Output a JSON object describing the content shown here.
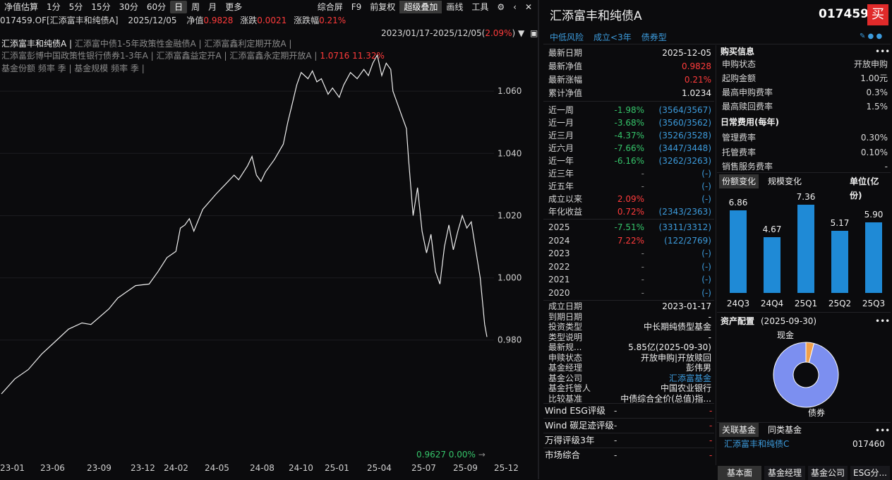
{
  "toolbar": {
    "left": [
      "净值估算",
      "1分",
      "5分",
      "15分",
      "30分",
      "60分",
      "日",
      "周",
      "月",
      "更多"
    ],
    "right": [
      "综合屏",
      "F9",
      "前复权",
      "超级叠加",
      "画线",
      "工具"
    ]
  },
  "info": {
    "code_name": "017459.OF[汇添富丰和纯债A]",
    "date": "2025/12/05",
    "nav_label": "净值",
    "nav": "0.9828",
    "chg_label": "涨跌",
    "chg": "0.0021",
    "pct_label": "涨跌幅",
    "pct": "0.21%"
  },
  "chart_overlay": {
    "range": "2023/01/17-2025/12/05(",
    "range_pct": "2.09%",
    "range_close": ")",
    "legend_main": "汇添富丰和纯债A |",
    "legend_1": "汇添富中债1-5年政策性金融债A |",
    "legend_2": "汇添富鑫利定期开放A |",
    "legend_3": "汇添富彭博中国政策性银行债券1-3年A |",
    "legend_4": "汇添富鑫益定开A |",
    "legend_5": "汇添富鑫永定期开放A |",
    "max_label": "1.0716 11.32%",
    "legend_6": "基金份额 频率 季 | 基金规模 频率 季 |",
    "min_label": "0.9627 0.00%"
  },
  "chart_data": {
    "type": "line",
    "x_ticks": [
      "23-01",
      "23-06",
      "23-09",
      "23-12",
      "24-02",
      "24-05",
      "24-08",
      "24-10",
      "25-01",
      "25-04",
      "25-07",
      "25-09",
      "25-12"
    ],
    "y_ticks": [
      "1.060",
      "1.040",
      "1.020",
      "1.000",
      "0.980"
    ],
    "ylim": [
      0.9627,
      1.0716
    ],
    "series": [
      {
        "points": [
          [
            0,
            0.9627
          ],
          [
            6,
            0.9675
          ],
          [
            12,
            0.9705
          ],
          [
            18,
            0.9755
          ],
          [
            24,
            0.9795
          ],
          [
            30,
            0.9835
          ],
          [
            36,
            0.9855
          ],
          [
            40,
            0.985
          ],
          [
            48,
            0.99
          ],
          [
            52,
            0.9935
          ],
          [
            56,
            0.9955
          ],
          [
            60,
            0.9975
          ],
          [
            66,
            0.998
          ],
          [
            70,
            1.002
          ],
          [
            74,
            1.0065
          ],
          [
            78,
            1.0085
          ],
          [
            80,
            1.016
          ],
          [
            82,
            1.017
          ],
          [
            84,
            1.019
          ],
          [
            86,
            1.015
          ],
          [
            90,
            1.022
          ],
          [
            96,
            1.027
          ],
          [
            100,
            1.03
          ],
          [
            104,
            1.033
          ],
          [
            106,
            1.0315
          ],
          [
            110,
            1.036
          ],
          [
            112,
            1.039
          ],
          [
            114,
            1.033
          ],
          [
            116,
            1.031
          ],
          [
            118,
            1.034
          ],
          [
            122,
            1.038
          ],
          [
            126,
            1.043
          ],
          [
            128,
            1.05
          ],
          [
            130,
            1.056
          ],
          [
            132,
            1.062
          ],
          [
            134,
            1.066
          ],
          [
            137,
            1.064
          ],
          [
            139,
            1.0665
          ],
          [
            141,
            1.063
          ],
          [
            143,
            1.064
          ],
          [
            146,
            1.059
          ],
          [
            148,
            1.061
          ],
          [
            151,
            1.058
          ],
          [
            153,
            1.062
          ],
          [
            156,
            1.066
          ],
          [
            159,
            1.064
          ],
          [
            162,
            1.067
          ],
          [
            164,
            1.065
          ],
          [
            166,
            1.069
          ],
          [
            168,
            1.0716
          ],
          [
            170,
            1.065
          ],
          [
            172,
            1.069
          ],
          [
            174,
            1.067
          ],
          [
            175,
            1.06
          ],
          [
            177,
            1.056
          ],
          [
            179,
            1.052
          ],
          [
            181,
            1.048
          ],
          [
            182,
            1.038
          ],
          [
            184,
            1.02
          ],
          [
            186,
            1.029
          ],
          [
            188,
            1.015
          ],
          [
            190,
            1.008
          ],
          [
            192,
            1.014
          ],
          [
            194,
            1.002
          ],
          [
            196,
            0.998
          ],
          [
            198,
            1.01
          ],
          [
            200,
            1.017
          ],
          [
            202,
            1.009
          ],
          [
            204,
            1.015
          ],
          [
            206,
            1.02
          ],
          [
            208,
            1.016
          ],
          [
            210,
            1.018
          ],
          [
            212,
            1.009
          ],
          [
            214,
            1.0
          ],
          [
            216,
            0.985
          ],
          [
            217,
            0.981
          ]
        ]
      }
    ]
  },
  "header": {
    "title": "汇添富丰和纯债A",
    "code": "017459",
    "buy": "买",
    "tags": [
      "中低风险",
      "成立<3年",
      "债券型"
    ]
  },
  "stats": [
    {
      "k": "最新日期",
      "v": "2025-12-05",
      "c": "white"
    },
    {
      "k": "最新净值",
      "v": "0.9828",
      "c": "red"
    },
    {
      "k": "最新涨幅",
      "v": "0.21%",
      "c": "red"
    },
    {
      "k": "累计净值",
      "v": "1.0234",
      "c": "white"
    }
  ],
  "perf": [
    {
      "k": "近一周",
      "v": "-1.98%",
      "r": "(3564/3567)",
      "c": "green"
    },
    {
      "k": "近一月",
      "v": "-3.68%",
      "r": "(3560/3562)",
      "c": "green"
    },
    {
      "k": "近三月",
      "v": "-4.37%",
      "r": "(3526/3528)",
      "c": "green"
    },
    {
      "k": "近六月",
      "v": "-7.66%",
      "r": "(3447/3448)",
      "c": "green"
    },
    {
      "k": "近一年",
      "v": "-6.16%",
      "r": "(3262/3263)",
      "c": "green"
    },
    {
      "k": "近三年",
      "v": "-",
      "r": "(-)",
      "c": "dim"
    },
    {
      "k": "近五年",
      "v": "-",
      "r": "(-)",
      "c": "dim"
    },
    {
      "k": "成立以来",
      "v": "2.09%",
      "r": "(-)",
      "c": "red"
    },
    {
      "k": "年化收益",
      "v": "0.72%",
      "r": "(2343/2363)",
      "c": "red"
    }
  ],
  "years": [
    {
      "k": "2025",
      "v": "-7.51%",
      "r": "(3311/3312)",
      "c": "green"
    },
    {
      "k": "2024",
      "v": "7.22%",
      "r": "(122/2769)",
      "c": "red"
    },
    {
      "k": "2023",
      "v": "-",
      "r": "(-)",
      "c": "dim"
    },
    {
      "k": "2022",
      "v": "-",
      "r": "(-)",
      "c": "dim"
    },
    {
      "k": "2021",
      "v": "-",
      "r": "(-)",
      "c": "dim"
    },
    {
      "k": "2020",
      "v": "-",
      "r": "(-)",
      "c": "dim"
    }
  ],
  "basic": [
    {
      "k": "成立日期",
      "v": "2023-01-17",
      "c": "white"
    },
    {
      "k": "到期日期",
      "v": "-",
      "c": "white"
    },
    {
      "k": "投资类型",
      "v": "中长期纯债型基金",
      "c": "white"
    },
    {
      "k": "类型说明",
      "v": "-",
      "c": "white"
    },
    {
      "k": "最新规...",
      "v": "5.85亿(2025-09-30)",
      "c": "white"
    },
    {
      "k": "申赎状态",
      "v": "开放申购|开放赎回",
      "c": "white"
    },
    {
      "k": "基金经理",
      "v": "彭伟男",
      "c": "white"
    },
    {
      "k": "基金公司",
      "v": "汇添富基金",
      "c": "blue"
    },
    {
      "k": "基金托管人",
      "v": "中国农业银行",
      "c": "white"
    },
    {
      "k": "比较基准",
      "v": "中债综合全价(总值)指...",
      "c": "white"
    }
  ],
  "ratings": [
    {
      "k": "Wind ESG评级",
      "v": "-",
      "v2": "-"
    },
    {
      "k": "Wind 碳足迹评级",
      "v": "-",
      "v2": "-"
    },
    {
      "k": "万得评级3年",
      "v": "-",
      "v2": "-"
    },
    {
      "k": "市场综合",
      "v": "-",
      "v2": "-"
    }
  ],
  "buy_info": {
    "title": "购买信息",
    "rows": [
      {
        "k": "申购状态",
        "v": "开放申购"
      },
      {
        "k": "起购金额",
        "v": "1.00元"
      },
      {
        "k": "最高申购费率",
        "v": "0.3%"
      },
      {
        "k": "最高赎回费率",
        "v": "1.5%"
      }
    ],
    "fee_title": "日常费用(每年)",
    "fees": [
      {
        "k": "管理费率",
        "v": "0.30%"
      },
      {
        "k": "托管费率",
        "v": "0.10%"
      },
      {
        "k": "销售服务费率",
        "v": "-"
      }
    ]
  },
  "share_chart": {
    "tab1": "份额变化",
    "tab2": "规模变化",
    "unit": "单位(亿份)",
    "bars": [
      {
        "q": "24Q3",
        "v": 6.86
      },
      {
        "q": "24Q4",
        "v": 4.67
      },
      {
        "q": "25Q1",
        "v": 7.36
      },
      {
        "q": "25Q2",
        "v": 5.17
      },
      {
        "q": "25Q3",
        "v": 5.9
      }
    ],
    "labels": [
      "6.86",
      "4.67",
      "7.36",
      "5.17",
      "5.90"
    ]
  },
  "asset": {
    "title": "资产配置",
    "date": "(2025-09-30)",
    "cash_label": "现金",
    "bond_label": "债券",
    "bond_pct": "96%",
    "bond_share": 96,
    "cash_share": 4,
    "bond_color": "#7c8ff0",
    "cash_color": "#f0a04a"
  },
  "related": {
    "tab1": "关联基金",
    "tab2": "同类基金",
    "name": "汇添富丰和纯债C",
    "code": "017460"
  },
  "bottom_tabs": [
    "基本面",
    "基金经理",
    "基金公司",
    "ESG分..."
  ],
  "more": "•••"
}
